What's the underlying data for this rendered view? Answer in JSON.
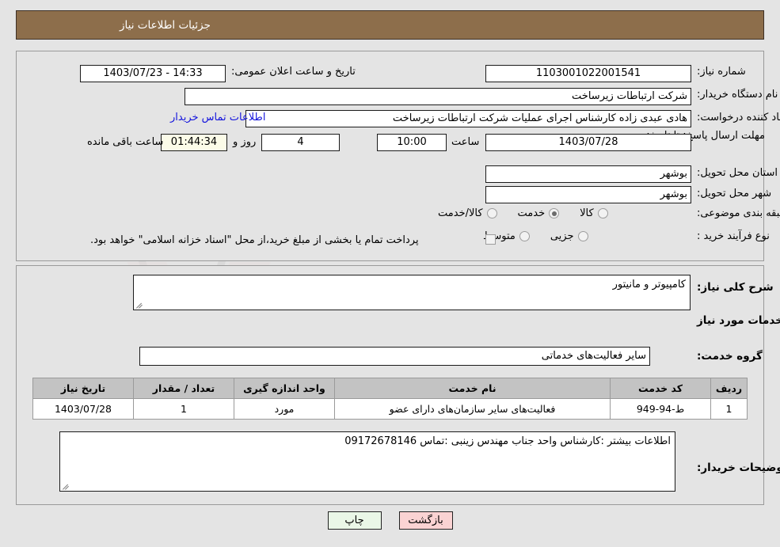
{
  "header": {
    "title": "جزئیات اطلاعات نیاز"
  },
  "fields": {
    "need_number_label": "شماره نیاز:",
    "need_number_value": "1103001022001541",
    "announce_label": "تاریخ و ساعت اعلان عمومی:",
    "announce_value": "14:33 - 1403/07/23",
    "buyer_org_label": "نام دستگاه خریدار:",
    "buyer_org_value": "شرکت ارتباطات زیرساخت",
    "creator_label": "ایجاد کننده درخواست:",
    "creator_value": "هادی عبدی زاده کارشناس اجرای عملیات شرکت ارتباطات زیرساخت",
    "contact_link": "اطلاعات تماس خریدار",
    "deadline_label": "مهلت ارسال پاسخ: تا تاریخ:",
    "deadline_date": "1403/07/28",
    "deadline_hour_label": "ساعت",
    "deadline_hour_value": "10:00",
    "days_value": "4",
    "days_label": "روز و",
    "timer_value": "01:44:34",
    "timer_label": "ساعت باقی مانده",
    "province_label": "استان محل تحویل:",
    "province_value": "بوشهر",
    "city_label": "شهر محل تحویل:",
    "city_value": "بوشهر",
    "category_label": "طبقه بندی موضوعی:",
    "category_options": [
      {
        "label": "کالا",
        "selected": false
      },
      {
        "label": "خدمت",
        "selected": true
      },
      {
        "label": "کالا/خدمت",
        "selected": false
      }
    ],
    "process_label": "نوع فرآیند خرید :",
    "process_options": [
      {
        "label": "جزیی",
        "selected": false
      },
      {
        "label": "متوسط",
        "selected": false
      }
    ],
    "treasury_checkbox_checked": false,
    "treasury_text": "پرداخت تمام یا بخشی از مبلغ خرید،از محل \"اسناد خزانه اسلامی\" خواهد بود."
  },
  "description": {
    "label": "شرح کلی نیاز:",
    "value": "کامپیوتر و مانیتور"
  },
  "services_section": {
    "heading": "اطلاعات خدمات مورد نیاز",
    "group_label": "گروه خدمت:",
    "group_value": "سایر فعالیت‌های خدماتی"
  },
  "table": {
    "columns": [
      "ردیف",
      "کد خدمت",
      "نام خدمت",
      "واحد اندازه گیری",
      "تعداد / مقدار",
      "تاریخ نیاز"
    ],
    "rows": [
      {
        "index": "1",
        "code": "ط-94-949",
        "name": "فعالیت‌های سایر سازمان‌های دارای عضو",
        "unit": "مورد",
        "qty": "1",
        "date": "1403/07/28"
      }
    ]
  },
  "buyer_notes": {
    "label": "توضیحات خریدار:",
    "value": "اطلاعات بیشتر :کارشناس واحد جناب مهندس زینبی :تماس 09172678146"
  },
  "buttons": {
    "print": "چاپ",
    "back": "بازگشت"
  },
  "watermark": {
    "text": "AriaTender.net"
  }
}
